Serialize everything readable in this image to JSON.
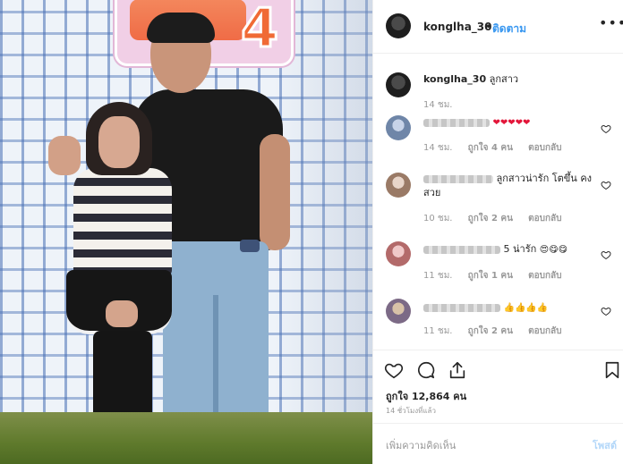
{
  "post": {
    "username": "konglha_30",
    "separator": "•",
    "follow_label": "ติดตาม",
    "more_label": "•••"
  },
  "caption": {
    "username": "konglha_30",
    "text": "ลูกสาว",
    "time": "14 ชม."
  },
  "comments": [
    {
      "text_suffix": "",
      "emoji": "❤❤❤❤❤",
      "time": "14 ชม.",
      "likes": "ถูกใจ 4 คน",
      "reply": "ตอบกลับ"
    },
    {
      "text_suffix": "ลูกสาวน่ารัก โตขึ้น คงสวย",
      "emoji": "",
      "time": "10 ชม.",
      "likes": "ถูกใจ 2 คน",
      "reply": "ตอบกลับ"
    },
    {
      "text_suffix": "5 น่ารัก",
      "emoji": "😍😋😋",
      "time": "11 ชม.",
      "likes": "ถูกใจ 1 คน",
      "reply": "ตอบกลับ"
    },
    {
      "text_suffix": "",
      "emoji": "👍👍👍👍",
      "time": "11 ชม.",
      "likes": "ถูกใจ 2 คน",
      "reply": "ตอบกลับ"
    }
  ],
  "likes_text": "ถูกใจ 12,864 คน",
  "posted_time": "14 ชั่วโมงที่แล้ว",
  "add_comment": {
    "placeholder": "เพิ่มความคิดเห็น",
    "post_label": "โพสต์"
  },
  "photo": {
    "sign_number": "4"
  },
  "colors": {
    "link": "#3897f0",
    "muted": "#999999",
    "text": "#262626",
    "post_disabled": "#b3d7f9"
  },
  "icons": [
    "more-options-icon",
    "heart-icon",
    "comment-icon",
    "share-icon",
    "bookmark-icon"
  ]
}
